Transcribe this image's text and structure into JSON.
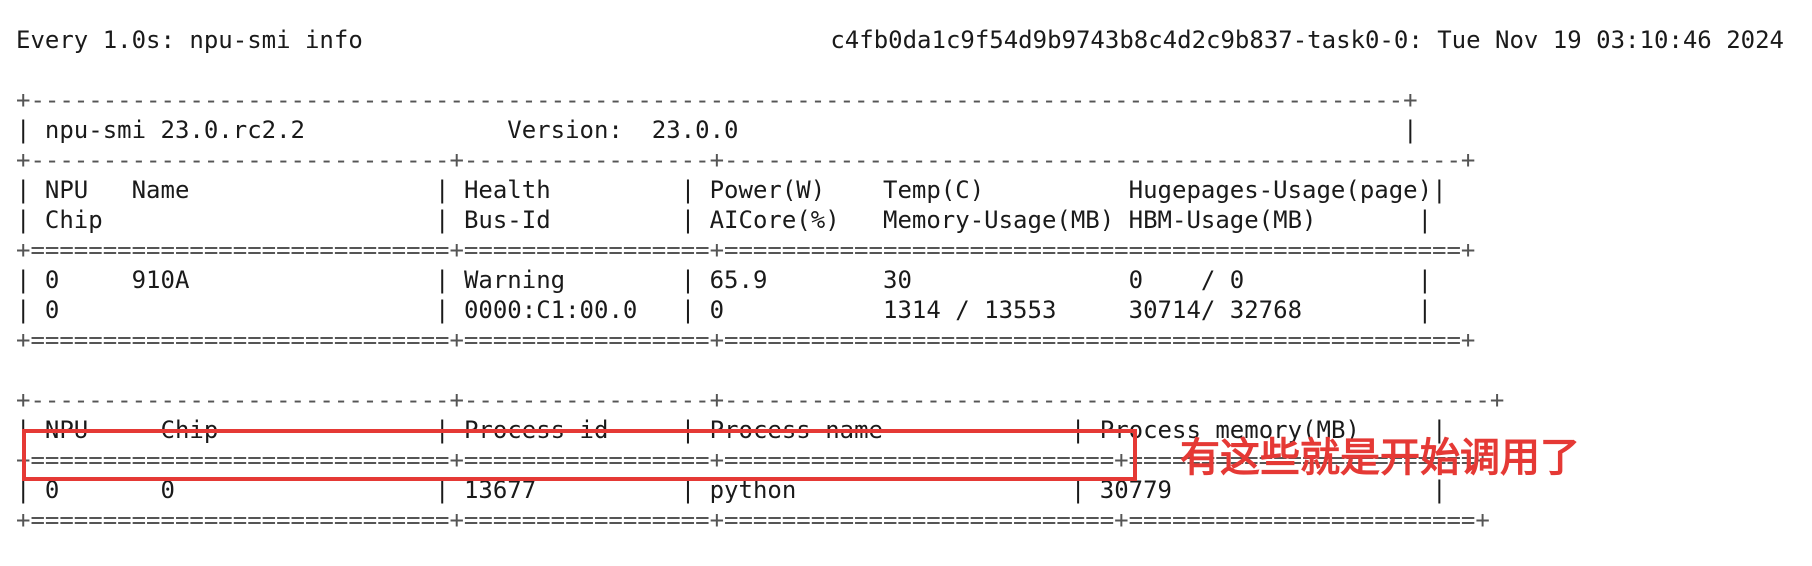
{
  "header": {
    "left": "Every 1.0s: npu-smi info",
    "right": "c4fb0da1c9f54d9b9743b8c4d2c9b837-task0-0: Tue Nov 19 03:10:46 2024"
  },
  "npu_smi": {
    "tool": "npu-smi 23.0.rc2.2",
    "version_label": "Version:",
    "version_value": "23.0.0",
    "columns": {
      "npu": "NPU",
      "name": "Name",
      "health": "Health",
      "power": "Power(W)",
      "temp": "Temp(C)",
      "hugepages": "Hugepages-Usage(page)",
      "chip": "Chip",
      "bus_id": "Bus-Id",
      "aicore": "AICore(%)",
      "memory_usage": "Memory-Usage(MB)",
      "hbm_usage": "HBM-Usage(MB)"
    },
    "device": {
      "npu": "0",
      "name": "910A",
      "health": "Warning",
      "power": "65.9",
      "temp": "30",
      "hugepages": "0    / 0",
      "chip": "0",
      "bus_id": "0000:C1:00.0",
      "aicore": "0",
      "memory_usage": "1314 / 13553",
      "hbm_usage": "30714/ 32768"
    }
  },
  "processes": {
    "columns": {
      "npu": "NPU",
      "chip": "Chip",
      "process_id": "Process id",
      "process_name": "Process name",
      "process_memory": "Process memory(MB)"
    },
    "rows": [
      {
        "npu": "0",
        "chip": "0",
        "process_id": "13677",
        "process_name": "python",
        "process_memory": "30779"
      }
    ]
  },
  "annotation": {
    "text": "有这些就是开始调用了",
    "color": "#e53935"
  }
}
